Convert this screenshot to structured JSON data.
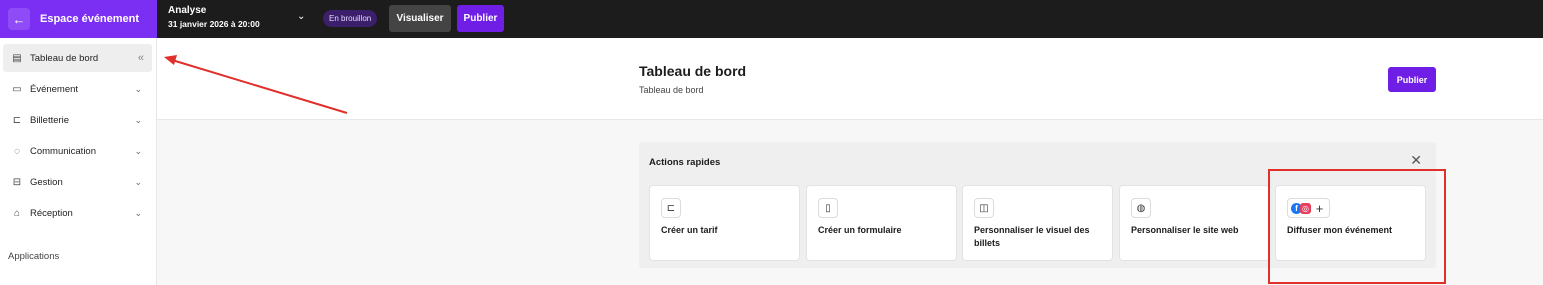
{
  "topbar": {
    "back_icon": "arrow-left-icon",
    "espace_label": "Espace événement",
    "event_name": "Analyse",
    "event_date": "31 janvier 2026 à 20:00",
    "status_badge": "En brouillon",
    "visualiser_label": "Visualiser",
    "publier_label": "Publier"
  },
  "sidebar": {
    "items": [
      {
        "label": "Tableau de bord",
        "icon": "dashboard-icon",
        "active": true
      },
      {
        "label": "Événement",
        "icon": "id-card-icon"
      },
      {
        "label": "Billetterie",
        "icon": "ticket-icon"
      },
      {
        "label": "Communication",
        "icon": "chat-bubble-icon"
      },
      {
        "label": "Gestion",
        "icon": "inbox-icon"
      },
      {
        "label": "Réception",
        "icon": "store-icon"
      }
    ],
    "section_label": "Applications"
  },
  "header": {
    "title": "Tableau de bord",
    "breadcrumb": "Tableau de bord",
    "publier_label": "Publier"
  },
  "quick_actions": {
    "title": "Actions rapides",
    "cards": [
      {
        "label": "Créer un tarif",
        "icon": "ticket-icon"
      },
      {
        "label": "Créer un formulaire",
        "icon": "clipboard-icon"
      },
      {
        "label": "Personnaliser le visuel des billets",
        "icon": "badge-icon"
      },
      {
        "label": "Personnaliser le site web",
        "icon": "globe-icon"
      },
      {
        "label": "Diffuser mon événement",
        "icon": "social-share-icon"
      }
    ]
  },
  "colors": {
    "accent": "#6f1ee6",
    "topbar": "#1c1c1c",
    "annotation": "#e0302c"
  }
}
